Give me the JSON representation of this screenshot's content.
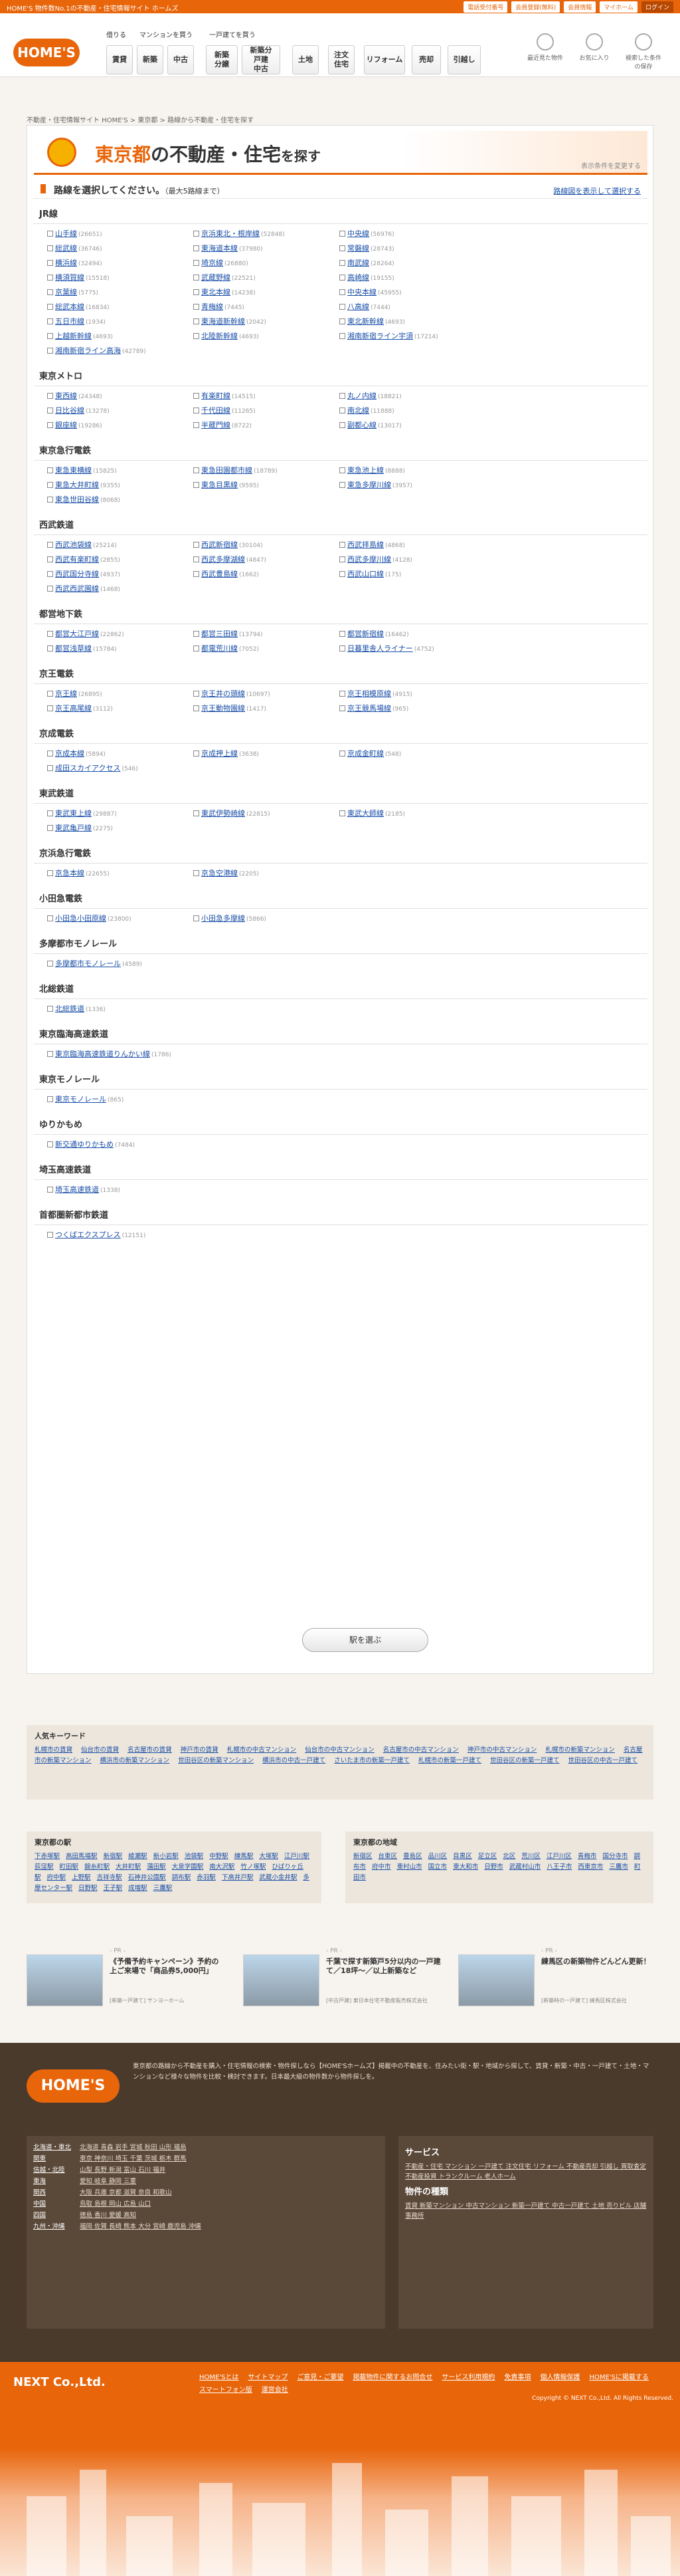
{
  "topbar": {
    "tagline": "HOME'S 物件数No.1の不動産・住宅情報サイト ホームズ",
    "links": [
      "電話受付番号",
      "会員登録(無料)",
      "会員情報",
      "マイホーム"
    ],
    "login": "ログイン"
  },
  "header": {
    "logo": "HOME'S",
    "sub1": "借りる",
    "sub2": "マンションを買う",
    "sub3": "一戸建てを買う",
    "nav": [
      "賃貸",
      "新築",
      "中古",
      "新築\n分譲",
      "新築分\n戸建\n中古",
      "土地",
      "注文\n住宅",
      "リフォーム",
      "売却",
      "引越し"
    ],
    "icons": [
      "最近見た物件",
      "お気に入り",
      "検索した条件の保存"
    ]
  },
  "breadcrumb": "不動産・住宅情報サイト HOME'S > 東京都 > 路線から不動産・住宅を探す",
  "hero": {
    "pref": "東京都",
    "rest": "の不動産・住宅",
    "tail": "を探す",
    "sub": "表示条件を変更する"
  },
  "select": {
    "title": "路線を選択してください。",
    "limit": "（最大5路線まで）",
    "map_link": "路線図を表示して選択する"
  },
  "groups": [
    {
      "name": "JR線",
      "lines": [
        [
          "山手線",
          "26651"
        ],
        [
          "京浜東北・根岸線",
          "52848"
        ],
        [
          "中央線",
          "56976"
        ],
        [
          "総武線",
          "36746"
        ],
        [
          "東海道本線",
          "37980"
        ],
        [
          "常磐線",
          "28743"
        ],
        [
          "横浜線",
          "32494"
        ],
        [
          "埼京線",
          "26880"
        ],
        [
          "南武線",
          "28264"
        ],
        [
          "横須賀線",
          "15518"
        ],
        [
          "武蔵野線",
          "22521"
        ],
        [
          "高崎線",
          "19155"
        ],
        [
          "京葉線",
          "5775"
        ],
        [
          "東北本線",
          "14238"
        ],
        [
          "中央本線",
          "45955"
        ],
        [
          "総武本線",
          "16834"
        ],
        [
          "青梅線",
          "7445"
        ],
        [
          "八高線",
          "7444"
        ],
        [
          "五日市線",
          "1934"
        ],
        [
          "東海道新幹線",
          "2042"
        ],
        [
          "東北新幹線",
          "4693"
        ],
        [
          "上越新幹線",
          "4693"
        ],
        [
          "北陸新幹線",
          "4693"
        ],
        [
          "湘南新宿ライン宇須",
          "17214"
        ],
        [
          "湘南新宿ライン高海",
          "42789"
        ]
      ]
    },
    {
      "name": "東京メトロ",
      "lines": [
        [
          "東西線",
          "24348"
        ],
        [
          "有楽町線",
          "14515"
        ],
        [
          "丸ノ内線",
          "18821"
        ],
        [
          "日比谷線",
          "13278"
        ],
        [
          "千代田線",
          "11265"
        ],
        [
          "南北線",
          "11888"
        ],
        [
          "銀座線",
          "19286"
        ],
        [
          "半蔵門線",
          "8722"
        ],
        [
          "副都心線",
          "13017"
        ]
      ]
    },
    {
      "name": "東京急行電鉄",
      "lines": [
        [
          "東急東横線",
          "15825"
        ],
        [
          "東急田園都市線",
          "18789"
        ],
        [
          "東急池上線",
          "8888"
        ],
        [
          "東急大井町線",
          "9355"
        ],
        [
          "東急目黒線",
          "9595"
        ],
        [
          "東急多摩川線",
          "3957"
        ],
        [
          "東急世田谷線",
          "8068"
        ]
      ]
    },
    {
      "name": "西武鉄道",
      "lines": [
        [
          "西武池袋線",
          "25214"
        ],
        [
          "西武新宿線",
          "30104"
        ],
        [
          "西武拝島線",
          "4868"
        ],
        [
          "西武有楽町線",
          "2855"
        ],
        [
          "西武多摩湖線",
          "4847"
        ],
        [
          "西武多摩川線",
          "4128"
        ],
        [
          "西武国分寺線",
          "4937"
        ],
        [
          "西武豊島線",
          "1662"
        ],
        [
          "西武山口線",
          "175"
        ],
        [
          "西武西武園線",
          "1468"
        ]
      ]
    },
    {
      "name": "都営地下鉄",
      "lines": [
        [
          "都営大江戸線",
          "22862"
        ],
        [
          "都営三田線",
          "13794"
        ],
        [
          "都営新宿線",
          "16462"
        ],
        [
          "都営浅草線",
          "15784"
        ],
        [
          "都電荒川線",
          "7052"
        ],
        [
          "日暮里舎人ライナー",
          "4752"
        ]
      ]
    },
    {
      "name": "京王電鉄",
      "lines": [
        [
          "京王線",
          "26895"
        ],
        [
          "京王井の頭線",
          "10697"
        ],
        [
          "京王相模原線",
          "4915"
        ],
        [
          "京王高尾線",
          "3112"
        ],
        [
          "京王動物園線",
          "1417"
        ],
        [
          "京王競馬場線",
          "965"
        ]
      ]
    },
    {
      "name": "京成電鉄",
      "lines": [
        [
          "京成本線",
          "5894"
        ],
        [
          "京成押上線",
          "3638"
        ],
        [
          "京成金町線",
          "548"
        ],
        [
          "成田スカイアクセス",
          "546"
        ]
      ]
    },
    {
      "name": "東武鉄道",
      "lines": [
        [
          "東武東上線",
          "29887"
        ],
        [
          "東武伊勢崎線",
          "22815"
        ],
        [
          "東武大師線",
          "2185"
        ],
        [
          "東武亀戸線",
          "2275"
        ]
      ]
    },
    {
      "name": "京浜急行電鉄",
      "lines": [
        [
          "京急本線",
          "22655"
        ],
        [
          "京急空港線",
          "2205"
        ]
      ]
    },
    {
      "name": "小田急電鉄",
      "lines": [
        [
          "小田急小田原線",
          "23800"
        ],
        [
          "小田急多摩線",
          "5866"
        ]
      ]
    },
    {
      "name": "多摩都市モノレール",
      "lines": [
        [
          "多摩都市モノレール",
          "4589"
        ]
      ]
    },
    {
      "name": "北総鉄道",
      "lines": [
        [
          "北総鉄道",
          "1336"
        ]
      ]
    },
    {
      "name": "東京臨海高速鉄道",
      "lines": [
        [
          "東京臨海高速鉄道りんかい線",
          "1786"
        ]
      ]
    },
    {
      "name": "東京モノレール",
      "lines": [
        [
          "東京モノレール",
          "865"
        ]
      ]
    },
    {
      "name": "ゆりかもめ",
      "lines": [
        [
          "新交通ゆりかもめ",
          "7484"
        ]
      ]
    },
    {
      "name": "埼玉高速鉄道",
      "lines": [
        [
          "埼玉高速鉄道",
          "1338"
        ]
      ]
    },
    {
      "name": "首都圏新都市鉄道",
      "lines": [
        [
          "つくばエクスプレス",
          "12151"
        ]
      ]
    }
  ],
  "go_button": "駅を選ぶ",
  "keywords": {
    "title": "人気キーワード",
    "items": [
      "札幌市の賃貸",
      "仙台市の賃貸",
      "名古屋市の賃貸",
      "神戸市の賃貸",
      "札幌市の中古マンション",
      "仙台市の中古マンション",
      "名古屋市の中古マンション",
      "神戸市の中古マンション",
      "札幌市の新築マンション",
      "名古屋市の新築マンション",
      "横浜市の新築マンション",
      "世田谷区の新築マンション",
      "横浜市の中古一戸建て",
      "さいたま市の新築一戸建て",
      "札幌市の新築一戸建て",
      "世田谷区の新築一戸建て",
      "世田谷区の中古一戸建て"
    ]
  },
  "stations": {
    "title": "東京都の駅",
    "items": [
      "下赤塚駅",
      "高田馬場駅",
      "新宿駅",
      "綾瀬駅",
      "新小岩駅",
      "池袋駅",
      "中野駅",
      "練馬駅",
      "大塚駅",
      "江戸川駅",
      "荻窪駅",
      "町田駅",
      "錦糸町駅",
      "大井町駅",
      "蒲田駅",
      "大泉学園駅",
      "南大沢駅",
      "竹ノ塚駅",
      "ひばりヶ丘駅",
      "府中駅",
      "上野駅",
      "吉祥寺駅",
      "石神井公園駅",
      "調布駅",
      "赤羽駅",
      "下高井戸駅",
      "武蔵小金井駅",
      "多摩センター駅",
      "日野駅",
      "王子駅",
      "成増駅",
      "三鷹駅"
    ]
  },
  "areas": {
    "title": "東京都の地域",
    "items": [
      "新宿区",
      "台東区",
      "豊島区",
      "品川区",
      "目黒区",
      "足立区",
      "北区",
      "荒川区",
      "江戸川区",
      "青梅市",
      "国分寺市",
      "調布市",
      "府中市",
      "東村山市",
      "国立市",
      "東大和市",
      "日野市",
      "武蔵村山市",
      "八王子市",
      "西東京市",
      "三鷹市",
      "町田市"
    ]
  },
  "pr": [
    {
      "tag": "- PR -",
      "text": "《予備予約キャンペーン》予約の上ご来場で「商品券5,000円」",
      "small": "[新築一戸建て] サンヨーホーム"
    },
    {
      "tag": "- PR -",
      "text": "千葉で探す新築戸5分以内の一戸建て／18坪～／以上新築など",
      "small": "[中古戸建] 東日本住宅不動産販売株式会社"
    },
    {
      "tag": "- PR -",
      "text": "練馬区の新築物件どんどん更新！",
      "small": "[新築時の一戸建て] 練馬区株式会社"
    }
  ],
  "footer": {
    "logo": "HOME'S",
    "desc": "東京都の路線から不動産を購入・住宅情報の検索・物件探しなら【HOME'Sホームズ】掲載中の不動産を、住みたい街・駅・地域から探して、賃貸・新築・中古・一戸建て・土地・マンションなど様々な物件を比較・検討できます。日本最大級の物件数から物件探しを。",
    "regions": [
      [
        "北海道・東北",
        "北海道 青森 岩手 宮城 秋田 山形 福島"
      ],
      [
        "関東",
        "東京 神奈川 埼玉 千葉 茨城 栃木 群馬"
      ],
      [
        "信越・北陸",
        "山梨 長野 新潟 富山 石川 福井"
      ],
      [
        "東海",
        "愛知 岐阜 静岡 三重"
      ],
      [
        "関西",
        "大阪 兵庫 京都 滋賀 奈良 和歌山"
      ],
      [
        "中国",
        "鳥取 島根 岡山 広島 山口"
      ],
      [
        "四国",
        "徳島 香川 愛媛 高知"
      ],
      [
        "九州・沖縄",
        "福岡 佐賀 長崎 熊本 大分 宮崎 鹿児島 沖縄"
      ]
    ],
    "service_title": "サービス",
    "services": "不動産・住宅 マンション 一戸建て 注文住宅 リフォーム 不動産売却 引越し 買取査定 不動産投資 トランクルーム 老人ホーム",
    "kind_title": "物件の種類",
    "kinds": "賃貸 新築マンション 中古マンション 新築一戸建て 中古一戸建て 土地 売りビル 店舗 事務所"
  },
  "bottom": {
    "company": "NEXT Co.,Ltd.",
    "links": [
      "HOME'Sとは",
      "サイトマップ",
      "ご意見・ご要望",
      "掲載物件に関するお問合せ",
      "サービス利用規約",
      "免責事項",
      "個人情報保護",
      "HOME'Sに掲載する",
      "スマートフォン版",
      "運営会社"
    ],
    "copyright": "Copyright © NEXT Co.,Ltd. All Rights Reserved."
  }
}
